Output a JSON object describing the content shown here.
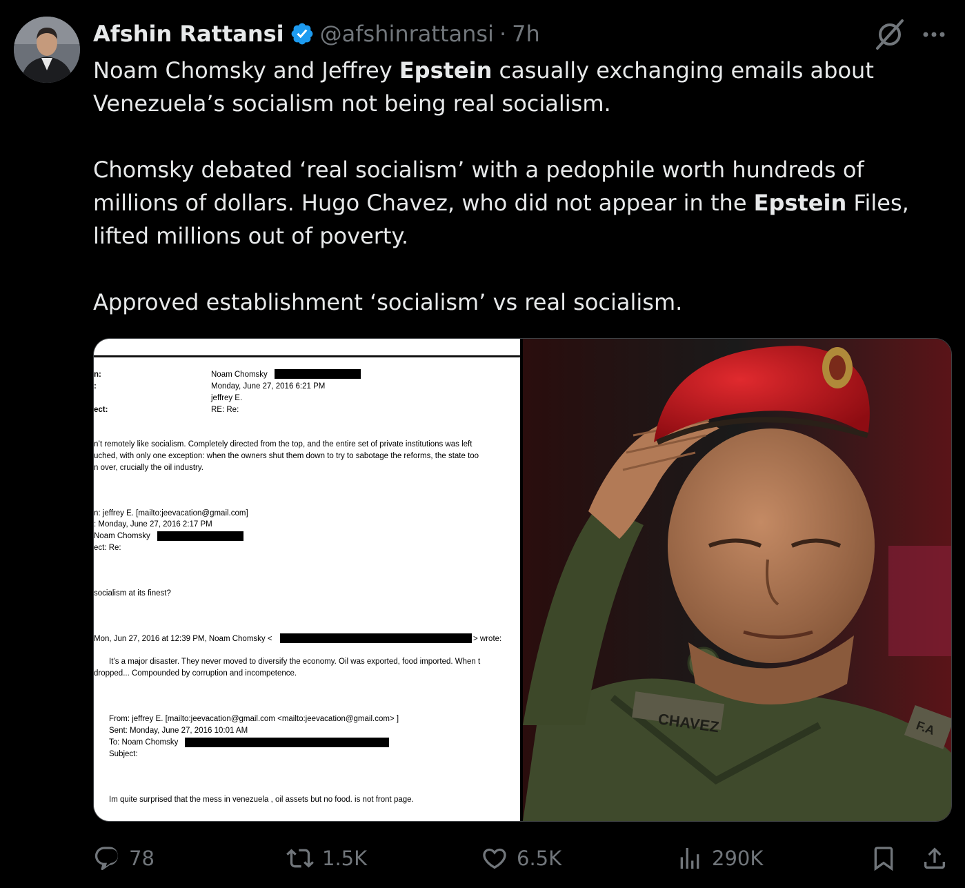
{
  "author": {
    "name": "Afshin Rattansi",
    "handle": "@afshinrattansi",
    "separator": "·",
    "time": "7h"
  },
  "icons": {
    "verified": "verified-badge-icon",
    "grok": "grok-icon",
    "more": "more-icon",
    "reply": "reply-icon",
    "repost": "repost-icon",
    "like": "like-icon",
    "views": "views-icon",
    "bookmark": "bookmark-icon",
    "share": "share-icon"
  },
  "colors": {
    "verified": "#1d9bf0",
    "muted": "#71767b",
    "text": "#e7e9ea",
    "beret": "#c8161e"
  },
  "tweet": {
    "p1_a": "Noam Chomsky and Jeffrey ",
    "p1_bold": "Epstein",
    "p1_b": " casually exchanging emails about Venezuela’s socialism not being real socialism.",
    "p2_a": "Chomsky debated ‘real socialism’ with a pedophile worth hundreds of millions of dollars. Hugo Chavez, who did not appear in the ",
    "p2_bold": "Epstein",
    "p2_b": " Files, lifted millions out of poverty.",
    "p3": "Approved establishment ‘socialism’ vs real socialism."
  },
  "document": {
    "h_from_label": "n:",
    "h_from": "Noam Chomsky",
    "h_sent_label": ":",
    "h_sent": "Monday, June 27, 2016 6:21 PM",
    "h_to": "jeffrey E.",
    "h_subj_label": "ect:",
    "h_subj": "RE: Re:",
    "body1": "n’t remotely like socialism.  Completely directed from the top, and the entire set of private institutions was left",
    "body2": "uched, with only one exception: when the owners shut them down to try to sabotage the reforms, the state too",
    "body3": "n over, crucially the oil industry.",
    "q1_from": "n: jeffrey E. [mailto:jeevacation@gmail.com]",
    "q1_sent": ": Monday, June 27, 2016 2:17 PM",
    "q1_to": "Noam Chomsky",
    "q1_subj": "ect: Re:",
    "q1_body": "socialism at its finest?",
    "q2_head": "Mon, Jun 27, 2016 at 12:39 PM, Noam Chomsky <",
    "q2_wrote": "> wrote:",
    "q2_body1": "It’s a major disaster.  They never moved to diversify the economy.  Oil was exported, food imported.  When t",
    "q2_body2": "dropped...  Compounded by corruption and incompetence.",
    "q3_from": "From: jeffrey E. [mailto:jeevacation@gmail.com <mailto:jeevacation@gmail.com> ]",
    "q3_sent": "Sent: Monday, June 27, 2016 10:01 AM",
    "q3_to": "To: Noam Chomsky",
    "q3_subj": "Subject:",
    "q3_body": "Im quite surprised that the mess in venezuela ,   oil assets  but no food.  is not front page."
  },
  "photo": {
    "nametag": "CHAVEZ",
    "patch": "F.A"
  },
  "actions": {
    "replies": "78",
    "reposts": "1.5K",
    "likes": "6.5K",
    "views": "290K"
  }
}
